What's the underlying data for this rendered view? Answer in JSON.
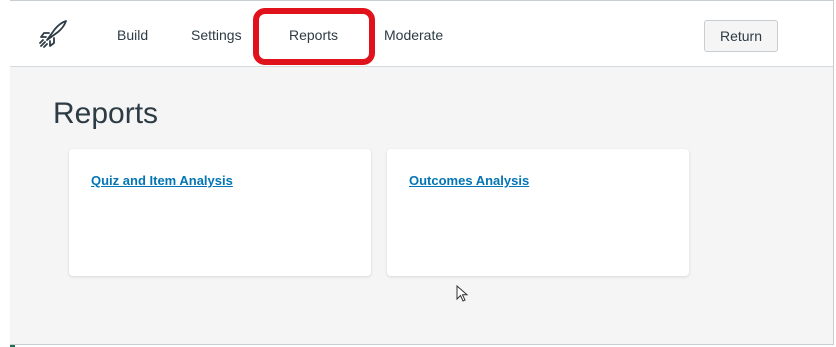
{
  "nav": {
    "logo_icon": "rocket-icon",
    "tabs": [
      {
        "label": "Build"
      },
      {
        "label": "Settings"
      },
      {
        "label": "Reports",
        "active": true
      },
      {
        "label": "Moderate"
      }
    ],
    "return_label": "Return"
  },
  "page": {
    "title": "Reports",
    "cards": [
      {
        "label": "Quiz and Item Analysis"
      },
      {
        "label": "Outcomes Analysis"
      }
    ]
  },
  "colors": {
    "accent": "#0374b5",
    "highlight": "#e0121b",
    "text": "#2d3b45",
    "content_bg": "#f5f5f5"
  }
}
